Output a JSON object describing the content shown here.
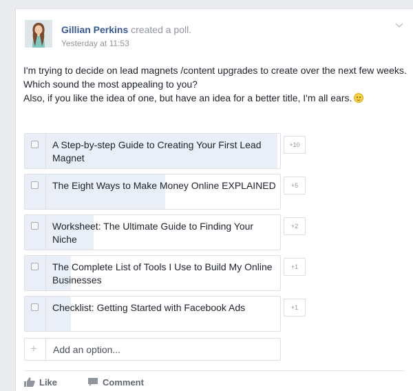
{
  "post": {
    "author": "Gillian Perkins",
    "action": " created a poll.",
    "timestamp": "Yesterday at 11:53",
    "text_lines": [
      "I'm trying to decide on lead magnets /content upgrades to create over the next few weeks. Which sound the most appealing to you?",
      "Also, if you like the idea of one, but have an idea for a better title, I'm all ears."
    ],
    "emoji": "smiley-emoji"
  },
  "poll": {
    "options": [
      {
        "label": "A Step-by-step Guide to Creating Your First Lead Magnet",
        "votes": "+10",
        "fill_fraction": 0.99
      },
      {
        "label": "The Eight Ways to Make Money Online EXPLAINED",
        "votes": "+5",
        "fill_fraction": 0.55
      },
      {
        "label": "Worksheet: The Ultimate Guide to Finding Your Niche",
        "votes": "+2",
        "fill_fraction": 0.27
      },
      {
        "label": "The Complete List of Tools I Use to Build My Online Businesses",
        "votes": "+1",
        "fill_fraction": 0.18
      },
      {
        "label": "Checklist: Getting Started with Facebook Ads",
        "votes": "+1",
        "fill_fraction": 0.18
      }
    ],
    "add_option": "Add an option..."
  },
  "actions": {
    "like": "Like",
    "comment": "Comment"
  },
  "colors": {
    "link": "#365899",
    "poll_fill": "#e9eef7",
    "meta": "#90949c"
  }
}
